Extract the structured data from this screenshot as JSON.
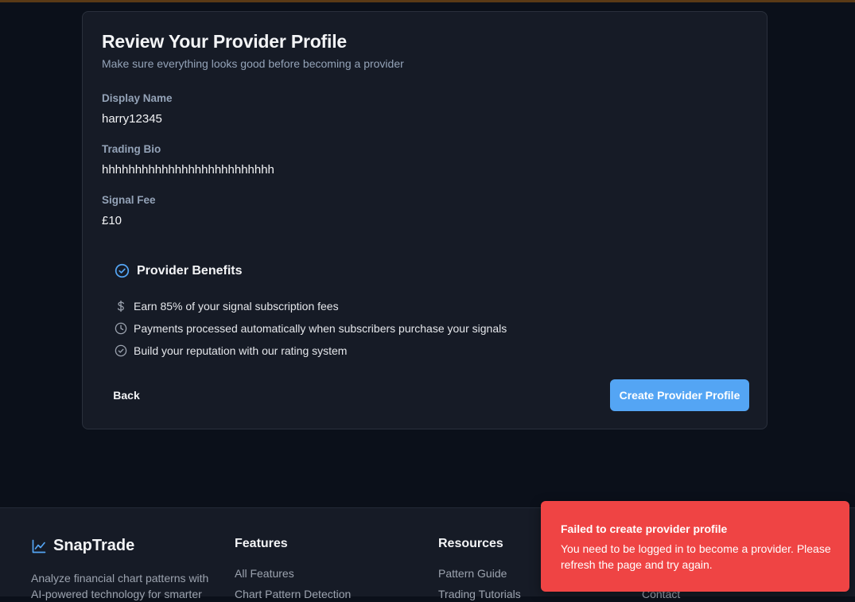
{
  "review": {
    "title": "Review Your Provider Profile",
    "subtitle": "Make sure everything looks good before becoming a provider",
    "fields": [
      {
        "label": "Display Name",
        "value": "harry12345"
      },
      {
        "label": "Trading Bio",
        "value": "hhhhhhhhhhhhhhhhhhhhhhhhhh"
      },
      {
        "label": "Signal Fee",
        "value": "£10"
      }
    ]
  },
  "benefits": {
    "title": "Provider Benefits",
    "items": [
      {
        "icon": "dollar-icon",
        "text": "Earn 85% of your signal subscription fees"
      },
      {
        "icon": "clock-icon",
        "text": "Payments processed automatically when subscribers purchase your signals"
      },
      {
        "icon": "check-circle-icon",
        "text": "Build your reputation with our rating system"
      }
    ]
  },
  "actions": {
    "back_label": "Back",
    "create_label": "Create Provider Profile"
  },
  "footer": {
    "brand": "SnapTrade",
    "description": "Analyze financial chart patterns with AI-powered technology for smarter",
    "columns": [
      {
        "title": "Features",
        "links": [
          "All Features",
          "Chart Pattern Detection"
        ]
      },
      {
        "title": "Resources",
        "links": [
          "Pattern Guide",
          "Trading Tutorials"
        ]
      },
      {
        "title": "",
        "links": [
          "Contact"
        ]
      }
    ]
  },
  "toast": {
    "title": "Failed to create provider profile",
    "message": "You need to be logged in to become a provider. Please refresh the page and try again."
  },
  "colors": {
    "background": "#0b101a",
    "card": "#161b26",
    "accent": "#54a5f4",
    "error": "#ef4444"
  }
}
